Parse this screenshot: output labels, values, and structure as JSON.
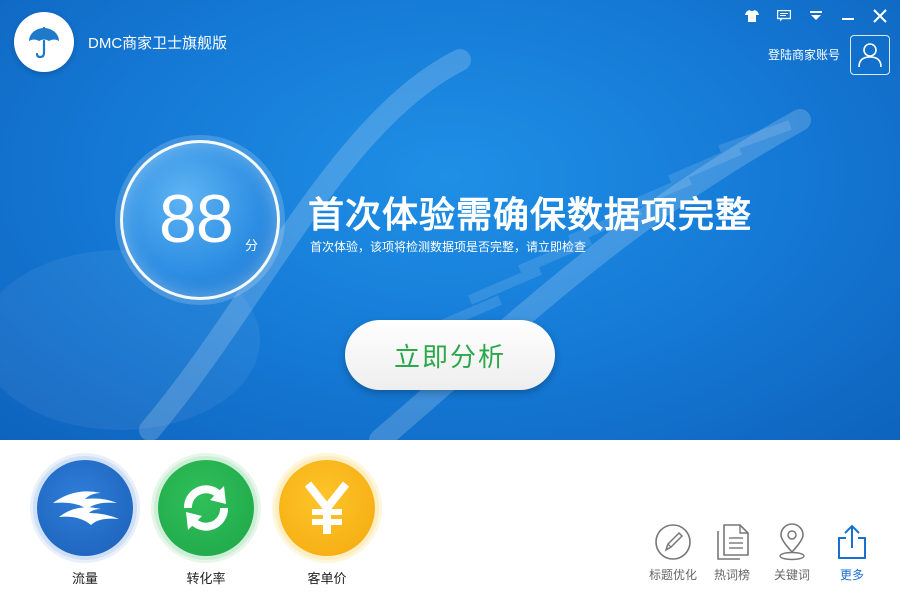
{
  "app": {
    "title": "DMC商家卫士旗舰版"
  },
  "header": {
    "login_label": "登陆商家账号"
  },
  "score": {
    "value": "88",
    "unit": "分"
  },
  "headline": "首次体验需确保数据项完整",
  "subline": "首次体验，该项将检测数据项是否完整，请立即检查",
  "analyze_button": "立即分析",
  "metrics": [
    {
      "label": "流量",
      "icon": "flow-icon",
      "color": "#2070cc"
    },
    {
      "label": "转化率",
      "icon": "refresh-arrows-icon",
      "color": "#27b04f"
    },
    {
      "label": "客单价",
      "icon": "yen-icon",
      "color": "#f7b51a"
    }
  ],
  "tools": [
    {
      "label": "标题优化",
      "icon": "pen-circle-icon"
    },
    {
      "label": "热词榜",
      "icon": "document-list-icon"
    },
    {
      "label": "关键词",
      "icon": "location-pin-icon"
    },
    {
      "label": "更多",
      "icon": "share-upload-icon",
      "active": true
    }
  ],
  "colors": {
    "hero_blue": "#1478d4",
    "accent_green": "#2aa84a",
    "active_blue": "#1a6fd0"
  }
}
